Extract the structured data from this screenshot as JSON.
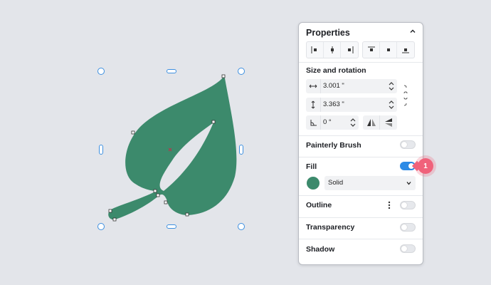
{
  "colors": {
    "leaf": "#3c8a6c",
    "accent": "#2d8be6",
    "badge": "#f0627b"
  },
  "panel": {
    "title": "Properties",
    "size_rotation": {
      "title": "Size and rotation",
      "width_value": "3.001 \"",
      "height_value": "3.363 \"",
      "rotation_value": "0 °"
    },
    "painterly_brush": {
      "label": "Painterly Brush",
      "enabled": false
    },
    "fill": {
      "label": "Fill",
      "enabled": true,
      "type_value": "Solid"
    },
    "outline": {
      "label": "Outline",
      "enabled": false
    },
    "transparency": {
      "label": "Transparency",
      "enabled": false
    },
    "shadow": {
      "label": "Shadow",
      "enabled": false
    }
  },
  "badge": {
    "number": "1"
  }
}
